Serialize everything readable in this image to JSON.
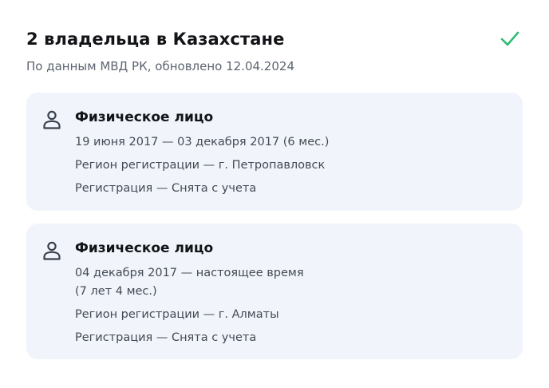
{
  "header": {
    "title": "2 владельца в Казахстане",
    "subtitle": "По данным МВД РК, обновлено 12.04.2024",
    "status_color": "#2fbd72",
    "status_icon": "check-icon"
  },
  "owners": [
    {
      "icon": "person-icon",
      "type": "Физическое лицо",
      "period": "19 июня 2017 — 03 декабря 2017 (6 мес.)",
      "region": "Регион регистрации — г. Петропавловск",
      "registration": "Регистрация — Снята с учета"
    },
    {
      "icon": "person-icon",
      "type": "Физическое лицо",
      "period_line1": "04 декабря 2017 — настоящее время",
      "period_line2": "(7 лет 4 мес.)",
      "region": "Регион регистрации — г. Алматы",
      "registration": "Регистрация — Снята с учета"
    }
  ]
}
